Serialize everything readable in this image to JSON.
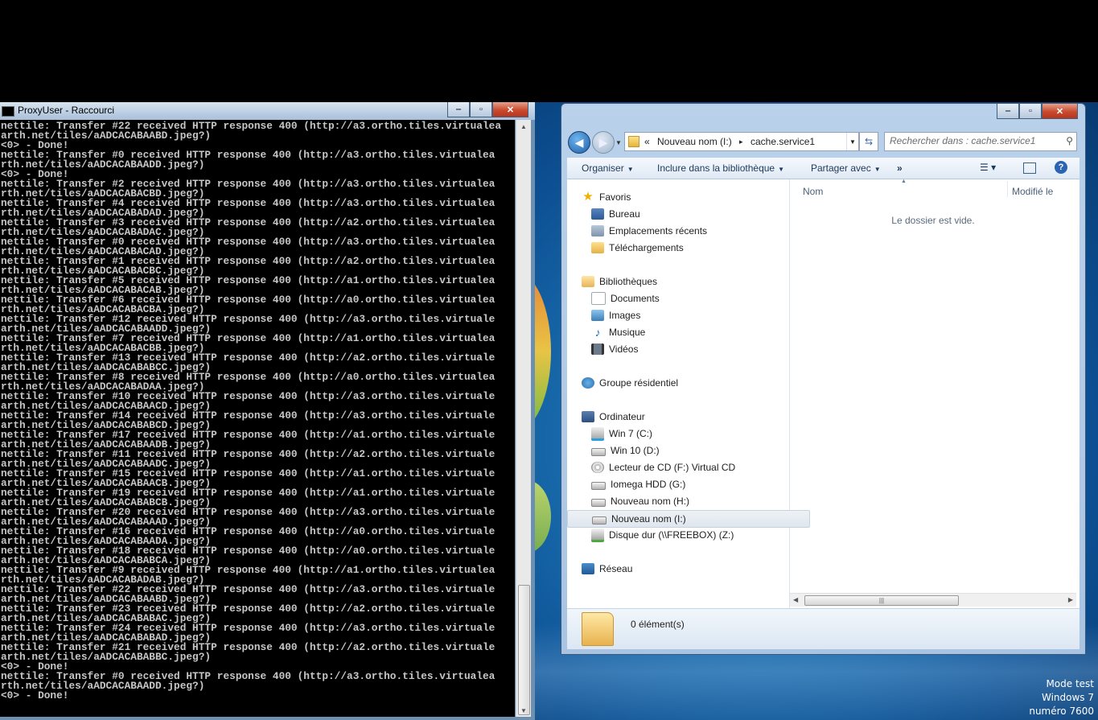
{
  "console": {
    "title": "ProxyUser - Raccourci",
    "lines": [
      "nettile: Transfer #22 received HTTP response 400 (http://a3.ortho.tiles.virtualea",
      "arth.net/tiles/aADCACABAABD.jpeg?)",
      "<0> - Done!",
      "nettile: Transfer #0 received HTTP response 400 (http://a3.ortho.tiles.virtualea",
      "rth.net/tiles/aADCACABAADD.jpeg?)",
      "<0> - Done!",
      "nettile: Transfer #2 received HTTP response 400 (http://a3.ortho.tiles.virtualea",
      "rth.net/tiles/aADCACABACBD.jpeg?)",
      "nettile: Transfer #4 received HTTP response 400 (http://a3.ortho.tiles.virtualea",
      "rth.net/tiles/aADCACABADAD.jpeg?)",
      "nettile: Transfer #3 received HTTP response 400 (http://a2.ortho.tiles.virtualea",
      "rth.net/tiles/aADCACABADAC.jpeg?)",
      "nettile: Transfer #0 received HTTP response 400 (http://a3.ortho.tiles.virtualea",
      "rth.net/tiles/aADCACABACAD.jpeg?)",
      "nettile: Transfer #1 received HTTP response 400 (http://a2.ortho.tiles.virtualea",
      "rth.net/tiles/aADCACABACBC.jpeg?)",
      "nettile: Transfer #5 received HTTP response 400 (http://a1.ortho.tiles.virtualea",
      "rth.net/tiles/aADCACABACAB.jpeg?)",
      "nettile: Transfer #6 received HTTP response 400 (http://a0.ortho.tiles.virtualea",
      "rth.net/tiles/aADCACABACBA.jpeg?)",
      "nettile: Transfer #12 received HTTP response 400 (http://a3.ortho.tiles.virtuale",
      "arth.net/tiles/aADCACABAADD.jpeg?)",
      "nettile: Transfer #7 received HTTP response 400 (http://a1.ortho.tiles.virtualea",
      "rth.net/tiles/aADCACABACBB.jpeg?)",
      "nettile: Transfer #13 received HTTP response 400 (http://a2.ortho.tiles.virtuale",
      "arth.net/tiles/aADCACABABCC.jpeg?)",
      "nettile: Transfer #8 received HTTP response 400 (http://a0.ortho.tiles.virtualea",
      "rth.net/tiles/aADCACABADAA.jpeg?)",
      "nettile: Transfer #10 received HTTP response 400 (http://a3.ortho.tiles.virtuale",
      "arth.net/tiles/aADCACABAACD.jpeg?)",
      "nettile: Transfer #14 received HTTP response 400 (http://a3.ortho.tiles.virtuale",
      "arth.net/tiles/aADCACABABCD.jpeg?)",
      "nettile: Transfer #17 received HTTP response 400 (http://a1.ortho.tiles.virtuale",
      "arth.net/tiles/aADCACABAADB.jpeg?)",
      "nettile: Transfer #11 received HTTP response 400 (http://a2.ortho.tiles.virtuale",
      "arth.net/tiles/aADCACABAADC.jpeg?)",
      "nettile: Transfer #15 received HTTP response 400 (http://a1.ortho.tiles.virtuale",
      "arth.net/tiles/aADCACABAACB.jpeg?)",
      "nettile: Transfer #19 received HTTP response 400 (http://a1.ortho.tiles.virtuale",
      "arth.net/tiles/aADCACABABCB.jpeg?)",
      "nettile: Transfer #20 received HTTP response 400 (http://a3.ortho.tiles.virtuale",
      "arth.net/tiles/aADCACABAAAD.jpeg?)",
      "nettile: Transfer #16 received HTTP response 400 (http://a0.ortho.tiles.virtuale",
      "arth.net/tiles/aADCACABAADA.jpeg?)",
      "nettile: Transfer #18 received HTTP response 400 (http://a0.ortho.tiles.virtuale",
      "arth.net/tiles/aADCACABABCA.jpeg?)",
      "nettile: Transfer #9 received HTTP response 400 (http://a1.ortho.tiles.virtualea",
      "rth.net/tiles/aADCACABADAB.jpeg?)",
      "nettile: Transfer #22 received HTTP response 400 (http://a3.ortho.tiles.virtuale",
      "arth.net/tiles/aADCACABAABD.jpeg?)",
      "nettile: Transfer #23 received HTTP response 400 (http://a2.ortho.tiles.virtuale",
      "arth.net/tiles/aADCACABABAC.jpeg?)",
      "nettile: Transfer #24 received HTTP response 400 (http://a3.ortho.tiles.virtuale",
      "arth.net/tiles/aADCACABABAD.jpeg?)",
      "nettile: Transfer #21 received HTTP response 400 (http://a2.ortho.tiles.virtuale",
      "arth.net/tiles/aADCACABABBC.jpeg?)",
      "<0> - Done!",
      "nettile: Transfer #0 received HTTP response 400 (http://a3.ortho.tiles.virtualea",
      "rth.net/tiles/aADCACABAADD.jpeg?)",
      "<0> - Done!"
    ]
  },
  "explorer": {
    "breadcrumb": {
      "overflow": "«",
      "parent": "Nouveau nom (I:)",
      "separator": "▸",
      "current": "cache.service1"
    },
    "search_placeholder": "Rechercher dans : cache.service1",
    "toolbar": {
      "organize": "Organiser",
      "include": "Inclure dans la bibliothèque",
      "share": "Partager avec",
      "more": "»"
    },
    "nav": {
      "favorites": "Favoris",
      "desktop": "Bureau",
      "recent": "Emplacements récents",
      "downloads": "Téléchargements",
      "libraries": "Bibliothèques",
      "documents": "Documents",
      "images": "Images",
      "music": "Musique",
      "videos": "Vidéos",
      "homegroup": "Groupe résidentiel",
      "computer": "Ordinateur",
      "drive_c": "Win 7 (C:)",
      "drive_d": "Win 10 (D:)",
      "drive_f": "Lecteur de CD (F:) Virtual CD",
      "drive_g": "Iomega HDD (G:)",
      "drive_h": "Nouveau nom (H:)",
      "drive_i": "Nouveau nom (I:)",
      "drive_z": "Disque dur (\\\\FREEBOX) (Z:)",
      "network": "Réseau"
    },
    "columns": {
      "name": "Nom",
      "modified": "Modifié le"
    },
    "empty_message": "Le dossier est vide.",
    "item_count": "0 élément(s)"
  },
  "watermark": {
    "line1": "Mode test",
    "line2": "Windows 7",
    "line3": "numéro 7600"
  }
}
